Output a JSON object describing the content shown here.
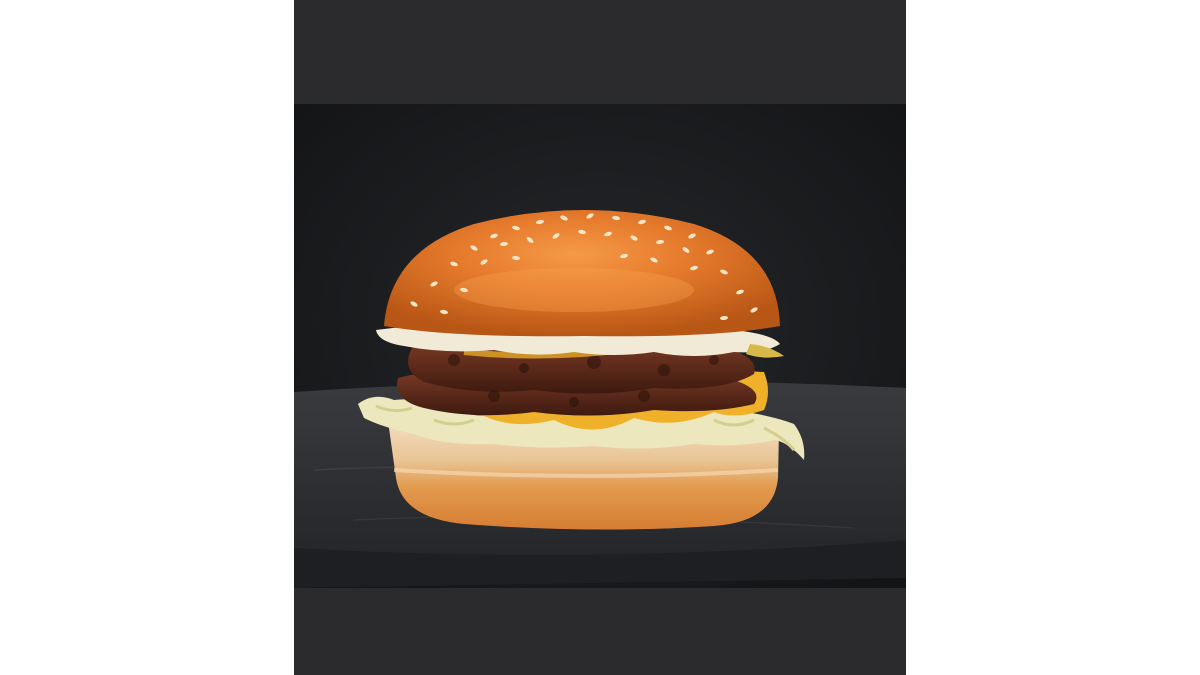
{
  "image": {
    "subject": "burger-photo",
    "colors": {
      "page_background": "#ffffff",
      "letterbox_band": "#2b2b2d",
      "backdrop": "#1c1d20",
      "slate": "#2e2f33",
      "bun_top": "#e07a2b",
      "bun_bottom": "#e3a15a",
      "patty": "#5a2a1c",
      "cheese": "#f0b12a",
      "lettuce": "#e9e6b8",
      "sauce": "#f1ead6",
      "sesame": "#f4e6c4"
    },
    "elements": [
      "letterbox-top",
      "letterbox-bottom",
      "backdrop",
      "slate-board",
      "bun-top",
      "sesame-seeds",
      "sauce-layer",
      "patty-top",
      "cheese",
      "patty-bottom",
      "lettuce",
      "bun-bottom"
    ]
  }
}
